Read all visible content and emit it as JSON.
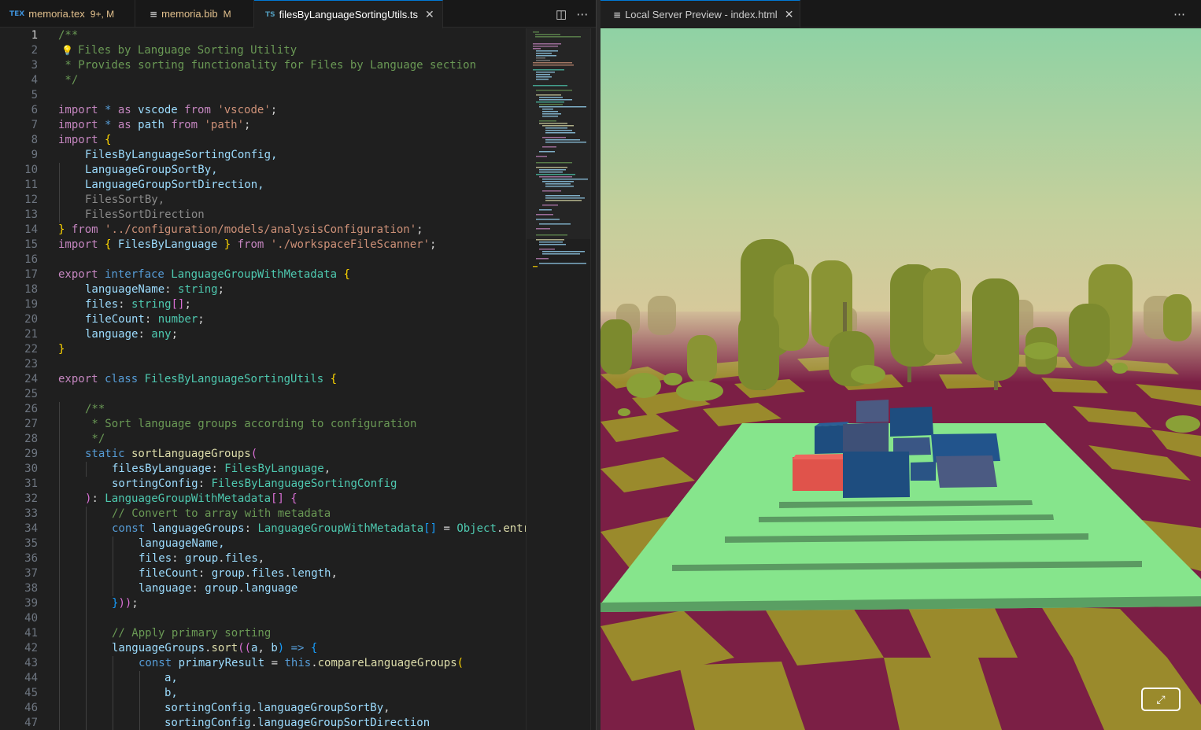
{
  "tabs": [
    {
      "icon": "TEX",
      "label": "memoria.tex",
      "status": "9+, M"
    },
    {
      "icon": "≡",
      "label": "memoria.bib",
      "status": "M"
    },
    {
      "icon": "TS",
      "label": "filesByLanguageSortingUtils.ts",
      "status": ""
    }
  ],
  "preview_tab": {
    "icon": "≡",
    "label": "Local Server Preview - index.html"
  },
  "line_numbers": [
    "1",
    "2",
    "3",
    "4",
    "5",
    "6",
    "7",
    "8",
    "9",
    "10",
    "11",
    "12",
    "13",
    "14",
    "15",
    "16",
    "17",
    "18",
    "19",
    "20",
    "21",
    "22",
    "23",
    "24",
    "25",
    "26",
    "27",
    "28",
    "29",
    "30",
    "31",
    "32",
    "33",
    "34",
    "35",
    "36",
    "37",
    "38",
    "39",
    "40",
    "41",
    "42",
    "43",
    "44",
    "45",
    "46",
    "47"
  ],
  "code_text": {
    "l1": "/**",
    "l2": "Files by Language Sorting Utility",
    "l3": " * Provides sorting functionality for Files by Language section",
    "l4": " */",
    "l6a": "import",
    "l6b": " * ",
    "l6c": "as",
    "l6d": " vscode ",
    "l6e": "from",
    "l6f": " 'vscode'",
    "l6g": ";",
    "l7a": "import",
    "l7b": " * ",
    "l7c": "as",
    "l7d": " path ",
    "l7e": "from",
    "l7f": " 'path'",
    "l7g": ";",
    "l8a": "import",
    "l8b": " {",
    "l9": "FilesByLanguageSortingConfig,",
    "l10": "LanguageGroupSortBy,",
    "l11": "LanguageGroupSortDirection,",
    "l12": "FilesSortBy,",
    "l13": "FilesSortDirection",
    "l14a": "}",
    "l14b": " from ",
    "l14c": "'../configuration/models/analysisConfiguration'",
    "l14d": ";",
    "l15a": "import",
    "l15b": " { ",
    "l15c": "FilesByLanguage",
    "l15d": " } ",
    "l15e": "from",
    "l15f": " './workspaceFileScanner'",
    "l15g": ";",
    "l17a": "export",
    "l17b": " interface ",
    "l17c": "LanguageGroupWithMetadata",
    "l17d": " {",
    "l18a": "languageName",
    "l18b": ": ",
    "l18c": "string",
    "l18d": ";",
    "l19a": "files",
    "l19b": ": ",
    "l19c": "string",
    "l19d": "[]",
    "l19e": ";",
    "l20a": "fileCount",
    "l20b": ": ",
    "l20c": "number",
    "l20d": ";",
    "l21a": "language",
    "l21b": ": ",
    "l21c": "any",
    "l21d": ";",
    "l22": "}",
    "l24a": "export",
    "l24b": " class ",
    "l24c": "FilesByLanguageSortingUtils",
    "l24d": " {",
    "l26": "/**",
    "l27": " * Sort language groups according to configuration",
    "l28": " */",
    "l29a": "static",
    "l29b": " sortLanguageGroups",
    "l29c": "(",
    "l30a": "filesByLanguage",
    "l30b": ": ",
    "l30c": "FilesByLanguage",
    "l30d": ",",
    "l31a": "sortingConfig",
    "l31b": ": ",
    "l31c": "FilesByLanguageSortingConfig",
    "l32a": ")",
    "l32b": ": ",
    "l32c": "LanguageGroupWithMetadata",
    "l32d": "[]",
    "l32e": " {",
    "l33": "// Convert to array with metadata",
    "l34a": "const",
    "l34b": " languageGroups",
    "l34c": ": ",
    "l34d": "LanguageGroupWithMetadata",
    "l34e": "[]",
    "l34f": " = ",
    "l34g": "Object",
    "l34h": ".",
    "l34i": "entr",
    "l35": "languageName,",
    "l36a": "files",
    "l36b": ": ",
    "l36c": "group",
    "l36d": ".",
    "l36e": "files",
    "l36f": ",",
    "l37a": "fileCount",
    "l37b": ": ",
    "l37c": "group",
    "l37d": ".",
    "l37e": "files",
    "l37f": ".",
    "l37g": "length",
    "l37h": ",",
    "l38a": "language",
    "l38b": ": ",
    "l38c": "group",
    "l38d": ".",
    "l38e": "language",
    "l39a": "}",
    "l39b": "))",
    "l39c": ";",
    "l41": "// Apply primary sorting",
    "l42a": "languageGroups",
    "l42b": ".",
    "l42c": "sort",
    "l42d": "((",
    "l42e": "a",
    "l42f": ", ",
    "l42g": "b",
    "l42h": ")",
    "l42i": " => ",
    "l42j": "{",
    "l43a": "const",
    "l43b": " primaryResult",
    "l43c": " = ",
    "l43d": "this",
    "l43e": ".",
    "l43f": "compareLanguageGroups",
    "l43g": "(",
    "l44": "a,",
    "l45": "b,",
    "l46a": "sortingConfig",
    "l46b": ".",
    "l46c": "languageGroupSortBy",
    "l46d": ",",
    "l47a": "sortingConfig",
    "l47b": ".",
    "l47c": "languageGroupSortDirection"
  },
  "colors": {
    "accent": "#0078d4",
    "editor_bg": "#1f1f1f",
    "platform": "#86e58c",
    "ground_red": "#7b1f45",
    "ground_olive": "#9a8a2c"
  },
  "icons": [
    "split-editor-icon",
    "more-actions-icon",
    "close-icon",
    "fullscreen-icon",
    "lightbulb-icon"
  ]
}
